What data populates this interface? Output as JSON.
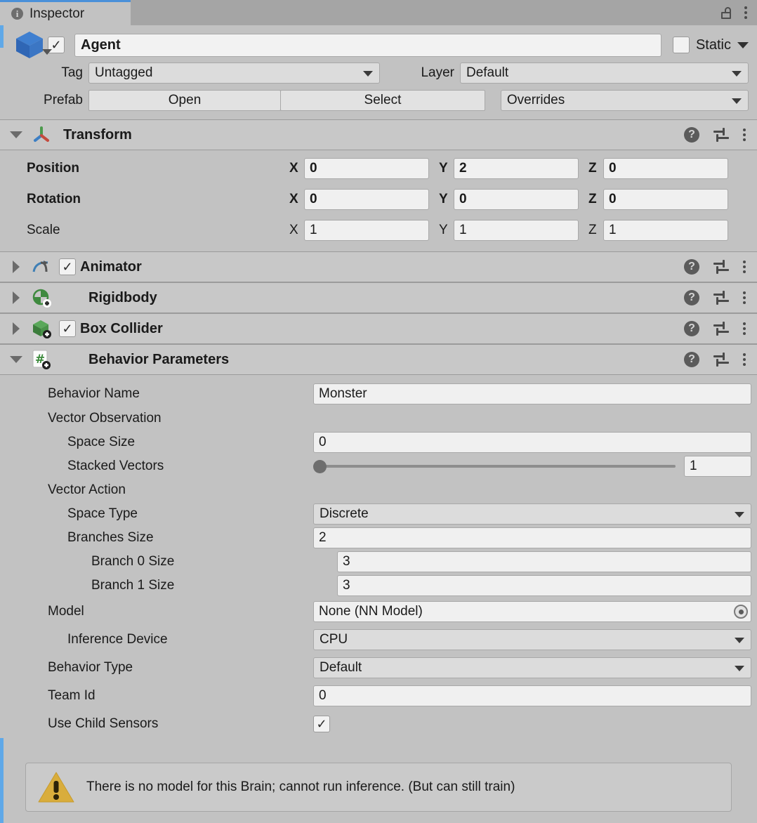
{
  "window": {
    "tab_label": "Inspector",
    "tab_icon": "info-icon",
    "lock_icon": "lock-icon",
    "menu_icon": "kebab-menu-icon",
    "accent_color": "#4a90d9",
    "override_stripe_color": "#5fa8e8"
  },
  "gameobject": {
    "enabled": true,
    "enabled_check": "✓",
    "icon": "cube-icon",
    "name": "Agent",
    "static_label": "Static",
    "static_checked": false,
    "tag_label": "Tag",
    "tag_value": "Untagged",
    "layer_label": "Layer",
    "layer_value": "Default",
    "prefab_label": "Prefab",
    "prefab_open": "Open",
    "prefab_select": "Select",
    "prefab_overrides": "Overrides"
  },
  "components": [
    {
      "name": "Transform",
      "icon": "transform-axis-icon",
      "expanded": true,
      "has_enable_toggle": false,
      "bold_title": true
    },
    {
      "name": "Animator",
      "icon": "animator-icon",
      "expanded": false,
      "has_enable_toggle": true,
      "enabled": true,
      "bold_title": true
    },
    {
      "name": "Rigidbody",
      "icon": "rigidbody-icon",
      "expanded": false,
      "has_enable_toggle": false,
      "bold_title": true
    },
    {
      "name": "Box Collider",
      "icon": "box-collider-icon",
      "expanded": false,
      "has_enable_toggle": true,
      "enabled": true,
      "bold_title": true
    },
    {
      "name": "Behavior Parameters",
      "icon": "script-icon",
      "expanded": true,
      "has_enable_toggle": false,
      "bold_title": true
    }
  ],
  "component_actions": {
    "help": "?",
    "help_name": "help-icon",
    "preset_name": "preset-icon",
    "menu_name": "kebab-menu-icon"
  },
  "transform": {
    "rows": [
      {
        "label": "Position",
        "bold": true,
        "x": "0",
        "y": "2",
        "z": "0"
      },
      {
        "label": "Rotation",
        "bold": true,
        "x": "0",
        "y": "0",
        "z": "0"
      },
      {
        "label": "Scale",
        "bold": false,
        "x": "1",
        "y": "1",
        "z": "1"
      }
    ],
    "axis_labels": {
      "x": "X",
      "y": "Y",
      "z": "Z"
    }
  },
  "behavior_parameters": {
    "behavior_name_label": "Behavior Name",
    "behavior_name_value": "Monster",
    "vector_observation_label": "Vector Observation",
    "space_size_label": "Space Size",
    "space_size_value": "0",
    "stacked_vectors_label": "Stacked Vectors",
    "stacked_vectors_value": "1",
    "stacked_vectors_slider_pct": 0,
    "vector_action_label": "Vector Action",
    "space_type_label": "Space Type",
    "space_type_value": "Discrete",
    "branches_size_label": "Branches Size",
    "branches_size_value": "2",
    "branch0_label": "Branch 0 Size",
    "branch0_value": "3",
    "branch1_label": "Branch 1 Size",
    "branch1_value": "3",
    "model_label": "Model",
    "model_value": "None (NN Model)",
    "inference_device_label": "Inference Device",
    "inference_device_value": "CPU",
    "behavior_type_label": "Behavior Type",
    "behavior_type_value": "Default",
    "team_id_label": "Team Id",
    "team_id_value": "0",
    "use_child_sensors_label": "Use Child Sensors",
    "use_child_sensors_checked": true,
    "use_child_sensors_check": "✓"
  },
  "warning": {
    "icon": "warning-triangle-icon",
    "text": "There is no model for this Brain; cannot run inference. (But can still train)",
    "color": "#d9ad3c"
  }
}
